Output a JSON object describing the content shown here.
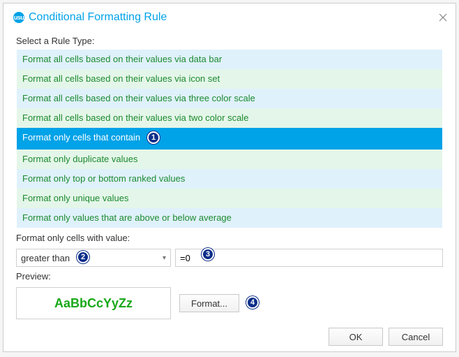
{
  "window": {
    "title": "Conditional Formatting Rule",
    "app_icon_text": "usu"
  },
  "labels": {
    "select_rule_type": "Select a Rule Type:",
    "format_only_cells_with_value": "Format only cells with value:",
    "preview": "Preview:"
  },
  "rule_types": [
    {
      "label": "Format all cells based on their values via data bar",
      "selected": false
    },
    {
      "label": "Format all cells based on their values via icon set",
      "selected": false
    },
    {
      "label": "Format all cells based on their values via three color scale",
      "selected": false
    },
    {
      "label": "Format all cells based on their values via two color scale",
      "selected": false
    },
    {
      "label": "Format only cells that contain",
      "selected": true
    },
    {
      "label": "Format only duplicate values",
      "selected": false
    },
    {
      "label": "Format only top or bottom ranked values",
      "selected": false
    },
    {
      "label": "Format only unique values",
      "selected": false
    },
    {
      "label": "Format only values that are above or below average",
      "selected": false
    }
  ],
  "condition": {
    "operator": "greater than",
    "value": "=0"
  },
  "preview_sample": "AaBbCcYyZz",
  "buttons": {
    "format": "Format...",
    "ok": "OK",
    "cancel": "Cancel"
  },
  "callouts": {
    "m1": "1",
    "m2": "2",
    "m3": "3",
    "m4": "4"
  },
  "colors": {
    "accent": "#00a2e8",
    "list_alt_a": "#dff1fb",
    "list_alt_b": "#e4f6e9",
    "preview_text": "#18a818"
  }
}
